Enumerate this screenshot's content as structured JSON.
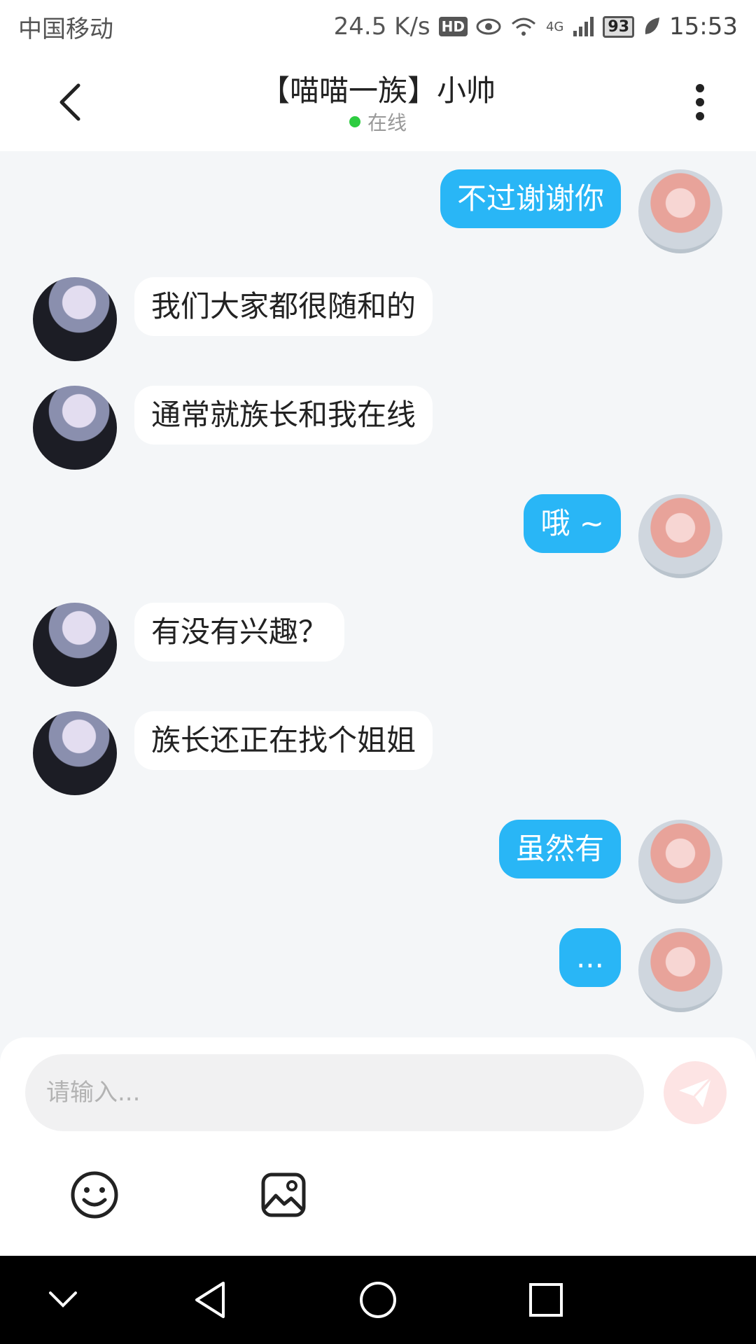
{
  "status_bar": {
    "carrier": "中国移动",
    "speed": "24.5 K/s",
    "hd": "HD",
    "network": "4G",
    "battery": "93",
    "time": "15:53"
  },
  "header": {
    "title": "【喵喵一族】小帅",
    "presence": "在线"
  },
  "messages": [
    {
      "side": "right",
      "text": "不过谢谢你"
    },
    {
      "side": "left",
      "text": "我们大家都很随和的"
    },
    {
      "side": "left",
      "text": "通常就族长和我在线"
    },
    {
      "side": "right",
      "text": "哦 ~"
    },
    {
      "side": "left",
      "text": "有没有兴趣？"
    },
    {
      "side": "left",
      "text": "族长还正在找个姐姐"
    },
    {
      "side": "right",
      "text": "虽然有"
    },
    {
      "side": "right",
      "text": "..."
    }
  ],
  "composer": {
    "placeholder": "请输入..."
  },
  "icons": {
    "back": "chevron-left-icon",
    "more": "more-vertical-icon",
    "send": "send-icon",
    "emoji": "emoji-icon",
    "image": "image-icon",
    "nav_hide": "chevron-down-icon",
    "nav_back": "triangle-back-icon",
    "nav_home": "circle-home-icon",
    "nav_recents": "square-recents-icon"
  },
  "colors": {
    "accent": "#29b6f6",
    "online": "#2ecc40",
    "background": "#f4f6f8"
  }
}
